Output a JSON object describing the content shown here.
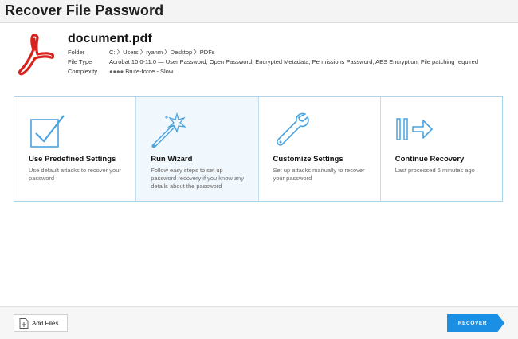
{
  "window": {
    "title": "Recover File Password"
  },
  "file": {
    "name": "document.pdf",
    "folder_label": "Folder",
    "folder_value": "C: 〉Users 〉ryanm 〉Desktop 〉PDFs",
    "type_label": "File Type",
    "type_value": "Acrobat 10.0-11.0 — User Password, Open Password, Encrypted Metadata, Permissions Password, AES Encryption, File patching required",
    "complexity_label": "Complexity",
    "complexity_dots": "●●●●",
    "complexity_value": "Brute-force - Slow"
  },
  "cards": [
    {
      "title": "Use Predefined Settings",
      "desc": "Use default attacks to recover your password",
      "icon": "checkbox-icon"
    },
    {
      "title": "Run Wizard",
      "desc": "Follow easy steps to set up password recovery if you know any details about the password",
      "icon": "magic-wand-icon"
    },
    {
      "title": "Customize Settings",
      "desc": "Set up attacks manually to recover your password",
      "icon": "wrench-icon"
    },
    {
      "title": "Continue Recovery",
      "desc": "Last processed 6 minutes ago",
      "icon": "resume-icon"
    }
  ],
  "footer": {
    "add_files_label": "Add Files",
    "recover_label": "RECOVER"
  },
  "colors": {
    "accent": "#1a8fe3",
    "card_border": "#a9d4ee",
    "pdf_red": "#d9221c"
  }
}
